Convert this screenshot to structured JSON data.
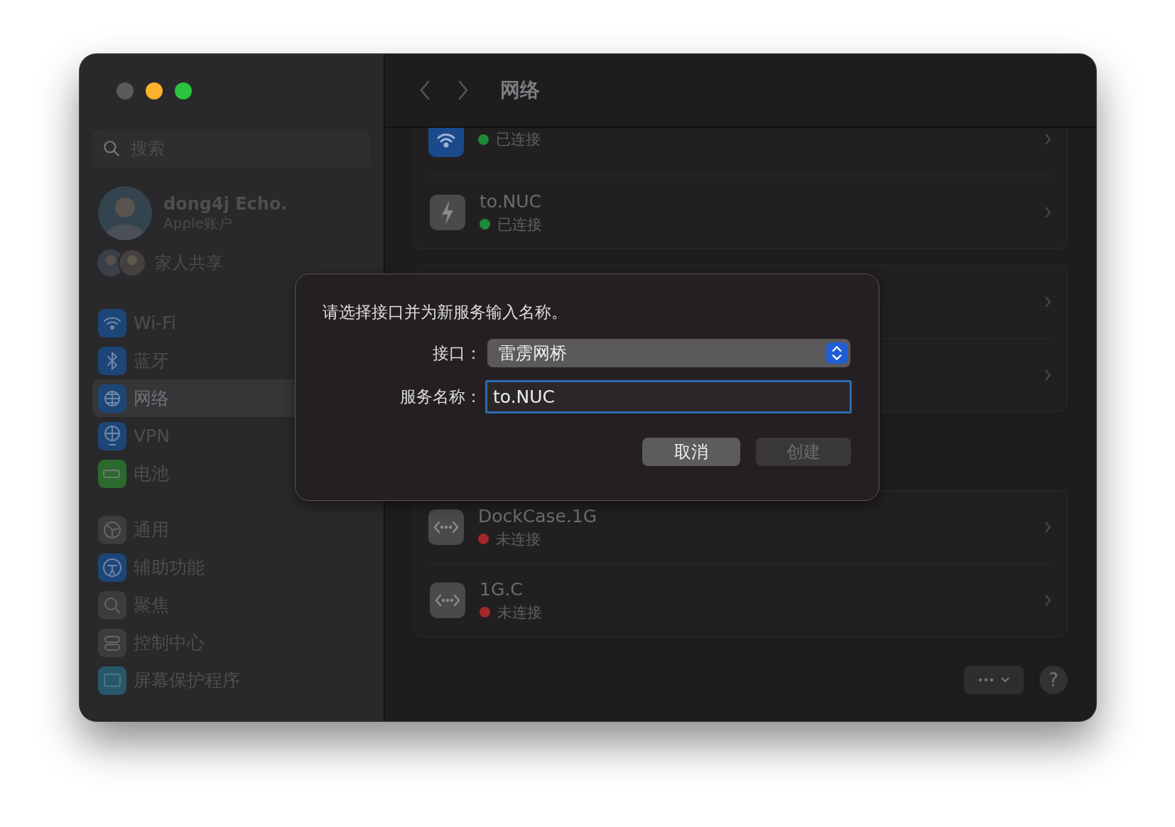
{
  "sidebar": {
    "search": {
      "placeholder": "搜索"
    },
    "account": {
      "name": "dong4j Echo.",
      "subtitle": "Apple账户"
    },
    "family": {
      "label": "家人共享"
    },
    "groups": [
      {
        "items": [
          {
            "label": "Wi-Fi",
            "selected": false
          },
          {
            "label": "蓝牙",
            "selected": false
          },
          {
            "label": "网络",
            "selected": true
          },
          {
            "label": "VPN",
            "selected": false
          },
          {
            "label": "电池",
            "selected": false
          }
        ]
      },
      {
        "items": [
          {
            "label": "通用",
            "selected": false
          },
          {
            "label": "辅助功能",
            "selected": false
          },
          {
            "label": "聚焦",
            "selected": false
          },
          {
            "label": "控制中心",
            "selected": false
          },
          {
            "label": "屏幕保护程序",
            "selected": false
          }
        ]
      }
    ]
  },
  "header": {
    "title": "网络"
  },
  "services": [
    {
      "rows": [
        {
          "kind": "wifi",
          "status": "已连接",
          "color": "#1f8a36"
        },
        {
          "kind": "thunderbolt",
          "name": "to.NUC",
          "status": "已连接",
          "color": "#1f8a36"
        }
      ]
    },
    {
      "rows": [
        {
          "kind": "ethernet",
          "name": "DockCase.1G",
          "status": "未连接",
          "color": "#a3282a"
        },
        {
          "kind": "ethernet",
          "name": "1G.C",
          "status": "未连接",
          "color": "#a3282a"
        }
      ]
    }
  ],
  "footer": {
    "help": "?"
  },
  "dialog": {
    "message": "请选择接口并为新服务输入名称。",
    "fields": [
      {
        "kind": "popup",
        "label": "接口：",
        "value": "雷雳网桥"
      },
      {
        "kind": "text",
        "label": "服务名称：",
        "value": "to.NUC"
      }
    ],
    "buttons": [
      {
        "label": "取消",
        "disabled": false
      },
      {
        "label": "创建",
        "disabled": true
      }
    ]
  }
}
